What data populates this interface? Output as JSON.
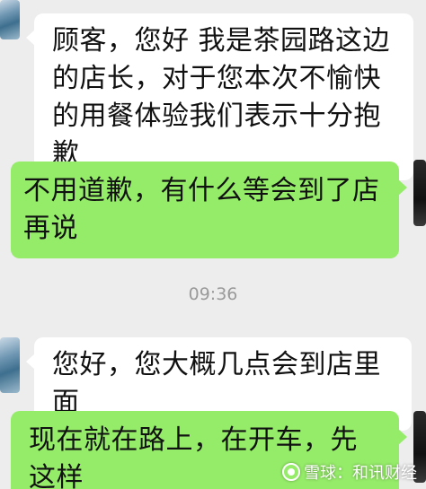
{
  "chat": {
    "messages": [
      {
        "sender": "other",
        "text": "顾客，您好 我是茶园路这边的店长，对于您本次不愉快的用餐体验我们表示十分抱歉"
      },
      {
        "sender": "self",
        "text": "不用道歉，有什么等会到了店再说"
      },
      {
        "sender": "other",
        "text": "您好，您大概几点会到店里面"
      },
      {
        "sender": "self",
        "text": "现在就在路上，在开车，先这样"
      }
    ],
    "timestamp": "09:36"
  },
  "watermark": {
    "text": "雪球：和讯财经"
  },
  "colors": {
    "background": "#ededed",
    "incoming_bubble": "#ffffff",
    "outgoing_bubble": "#95ec69",
    "timestamp": "#9a9a9a"
  }
}
